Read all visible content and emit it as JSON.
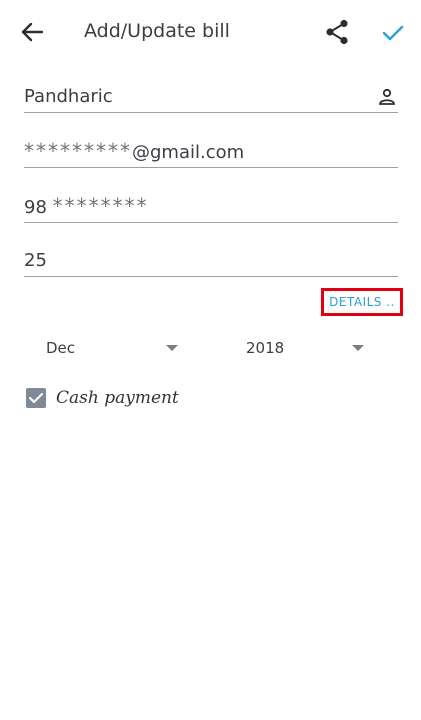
{
  "toolbar": {
    "title": "Add/Update bill",
    "icons": {
      "back": "arrow-left-icon",
      "share": "share-icon",
      "done": "check-icon"
    }
  },
  "form": {
    "name_value": "Pandharic",
    "email_mask": "*********",
    "email_suffix": "@gmail.com",
    "phone_prefix": "98",
    "phone_mask": "********",
    "amount_value": "25",
    "details_label": "DETAILS ..",
    "month_value": "Dec",
    "year_value": "2018",
    "cash_payment_label": "Cash payment",
    "cash_payment_checked": true
  },
  "colors": {
    "accent": "#2b9fd6",
    "highlight_border": "#e00012",
    "checkbox": "#7f8a96"
  }
}
